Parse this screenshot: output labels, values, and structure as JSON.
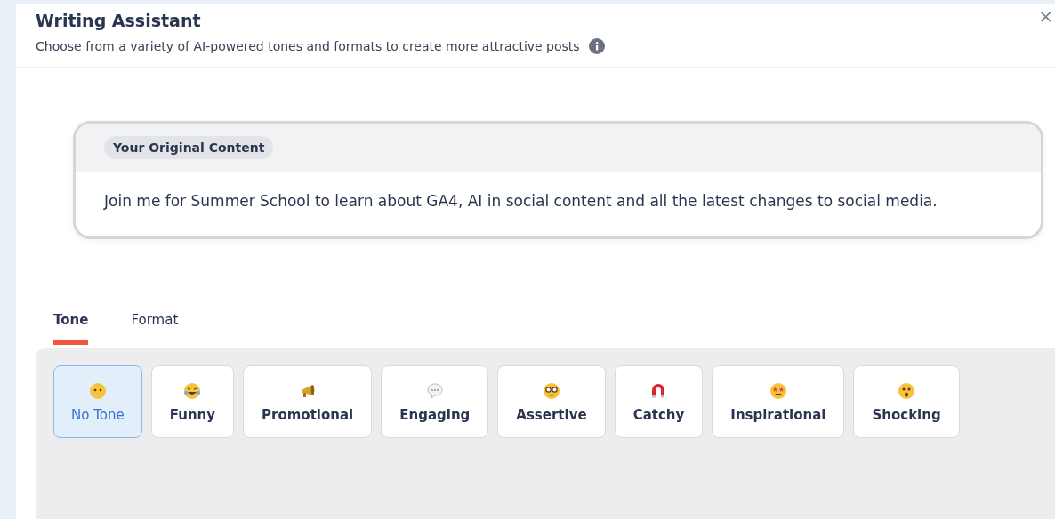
{
  "header": {
    "title": "Writing Assistant",
    "subtitle": "Choose from a variety of AI-powered tones and formats to create more attractive posts",
    "close": "×"
  },
  "original": {
    "badge": "Your Original Content",
    "text": "Join me for Summer School to learn about GA4, AI in social content and all the latest changes to social media."
  },
  "tabs": [
    {
      "label": "Tone",
      "selected": true
    },
    {
      "label": "Format",
      "selected": false
    }
  ],
  "tones": [
    {
      "label": "No Tone",
      "selected": true
    },
    {
      "label": "Funny",
      "selected": false
    },
    {
      "label": "Promotional",
      "selected": false
    },
    {
      "label": "Engaging",
      "selected": false
    },
    {
      "label": "Assertive",
      "selected": false
    },
    {
      "label": "Catchy",
      "selected": false
    },
    {
      "label": "Inspirational",
      "selected": false
    },
    {
      "label": "Shocking",
      "selected": false
    }
  ]
}
